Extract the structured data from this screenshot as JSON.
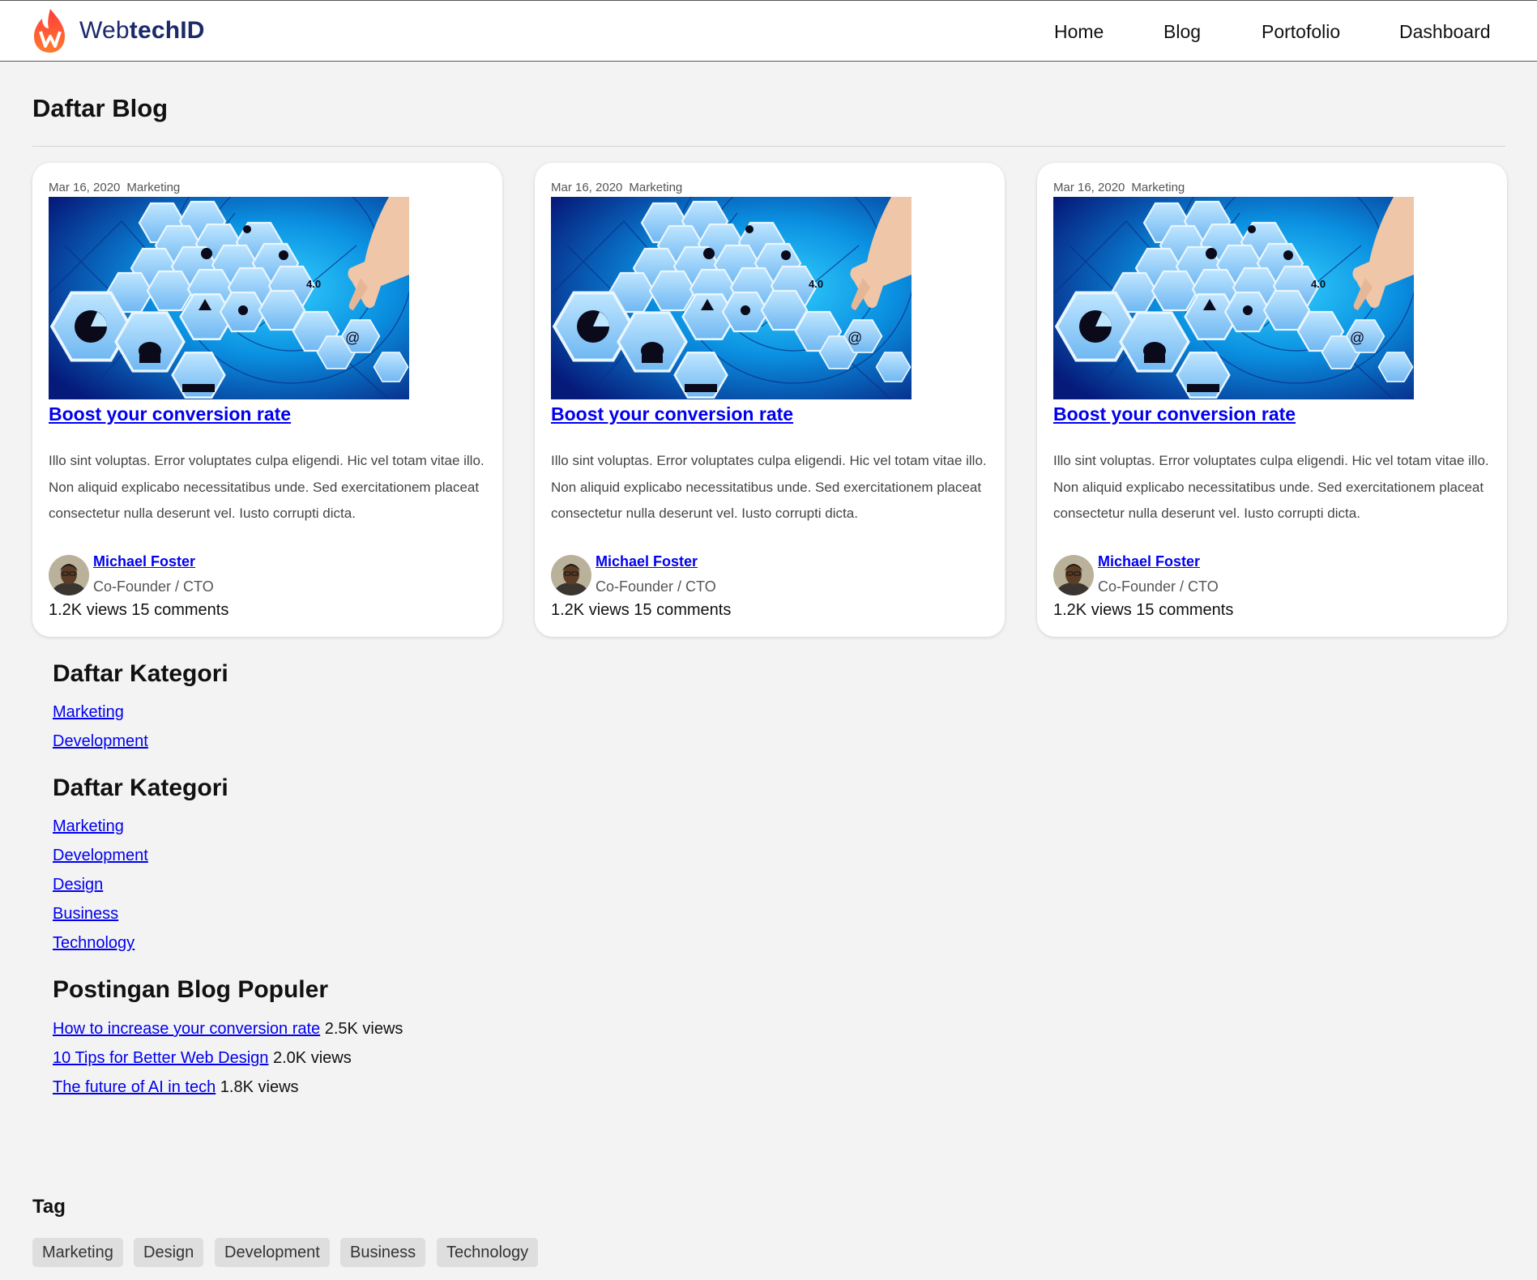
{
  "header": {
    "logo": {
      "text_regular": "Web",
      "text_bold": "techID"
    },
    "nav": [
      "Home",
      "Blog",
      "Portofolio",
      "Dashboard"
    ]
  },
  "page_title": "Daftar Blog",
  "posts": [
    {
      "date": "Mar 16, 2020",
      "category": "Marketing",
      "title": "Boost your conversion rate",
      "excerpt": "Illo sint voluptas. Error voluptates culpa eligendi. Hic vel totam vitae illo. Non aliquid explicabo necessitatibus unde. Sed exercitationem placeat consectetur nulla deserunt vel. Iusto corrupti dicta.",
      "author": "Michael Foster",
      "role": "Co-Founder / CTO",
      "stats": "1.2K views 15 comments"
    },
    {
      "date": "Mar 16, 2020",
      "category": "Marketing",
      "title": "Boost your conversion rate",
      "excerpt": "Illo sint voluptas. Error voluptates culpa eligendi. Hic vel totam vitae illo. Non aliquid explicabo necessitatibus unde. Sed exercitationem placeat consectetur nulla deserunt vel. Iusto corrupti dicta.",
      "author": "Michael Foster",
      "role": "Co-Founder / CTO",
      "stats": "1.2K views 15 comments"
    },
    {
      "date": "Mar 16, 2020",
      "category": "Marketing",
      "title": "Boost your conversion rate",
      "excerpt": "Illo sint voluptas. Error voluptates culpa eligendi. Hic vel totam vitae illo. Non aliquid explicabo necessitatibus unde. Sed exercitationem placeat consectetur nulla deserunt vel. Iusto corrupti dicta.",
      "author": "Michael Foster",
      "role": "Co-Founder / CTO",
      "stats": "1.2K views 15 comments"
    }
  ],
  "categories_1": {
    "title": "Daftar Kategori",
    "items": [
      "Marketing",
      "Development"
    ]
  },
  "categories_2": {
    "title": "Daftar Kategori",
    "items": [
      "Marketing",
      "Development",
      "Design",
      "Business",
      "Technology"
    ]
  },
  "popular": {
    "title": "Postingan Blog Populer",
    "items": [
      {
        "title": "How to increase your conversion rate",
        "views": "2.5K views"
      },
      {
        "title": "10 Tips for Better Web Design",
        "views": "2.0K views"
      },
      {
        "title": "The future of AI in tech",
        "views": "1.8K views"
      }
    ]
  },
  "tags": {
    "title": "Tag",
    "items": [
      "Marketing",
      "Design",
      "Development",
      "Business",
      "Technology"
    ]
  }
}
